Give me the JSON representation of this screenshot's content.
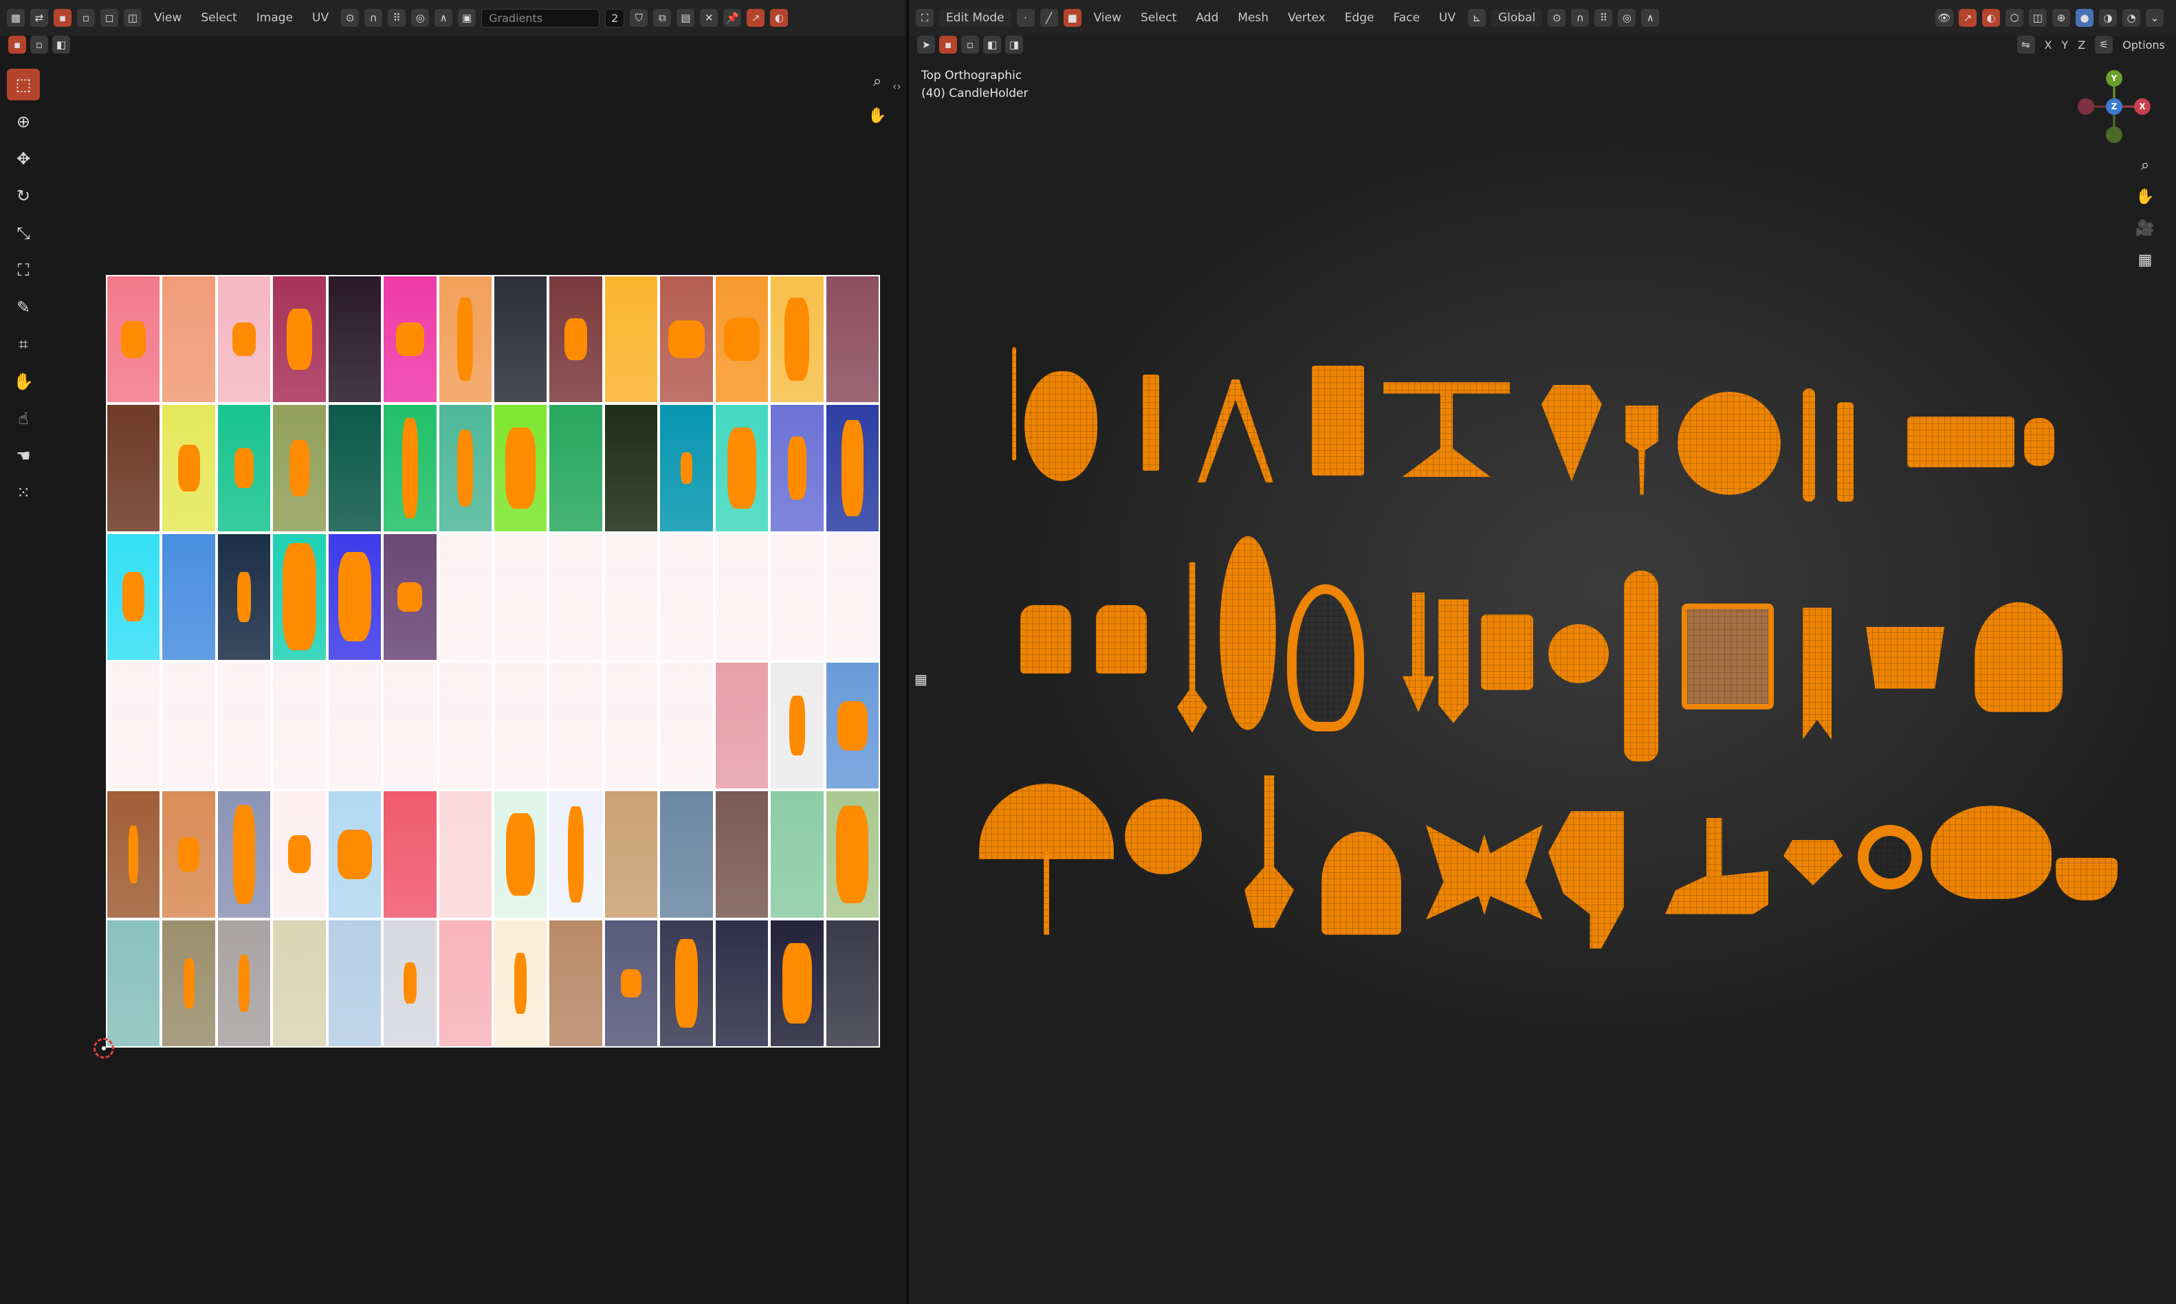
{
  "uv_editor": {
    "header": {
      "menus": [
        "View",
        "Select",
        "Image",
        "UV"
      ],
      "image_name": "Gradients",
      "users_count": "2"
    },
    "nav_icons": [
      "zoom-icon",
      "hand-icon"
    ],
    "tools": [
      "select-box-icon",
      "cursor-icon",
      "move-icon",
      "rotate-icon",
      "scale-icon",
      "transform-icon",
      "annotate-icon",
      "rip-icon",
      "grab-icon",
      "relax-icon",
      "pinch-icon",
      "sample-icon"
    ],
    "grid": {
      "columns": 14,
      "rows": 6,
      "tiles": [
        [
          "#f37a8a",
          "#f19c78",
          "#f5b8c3",
          "#a9335a",
          "#2a1a28",
          "#ee3aa8",
          "#f2a05b",
          "#2f2f3a",
          "#7b3b3d",
          "#fbb52f",
          "#b65e52",
          "#f79a2c",
          "#f7c04b",
          "#8d4f61"
        ],
        [
          "#6f3b26",
          "#e6e85a",
          "#19c48e",
          "#93a05a",
          "#0e5a4a",
          "#22c068",
          "#4fb899",
          "#7ee62e",
          "#28a85f",
          "#1e2f15",
          "#0897b0",
          "#43d8c0",
          "#6b73d6",
          "#2d3fa4"
        ],
        [
          "#35dff4",
          "#4a8ee0",
          "#1b2f48",
          "#1fd1b4",
          "#3e3bea",
          "#6b4877",
          "#fdf2f4",
          "#fdf2f4",
          "#fdf2f4",
          "#fdf2f4",
          "#fdf2f4",
          "#fdf2f4",
          "#fdf2f4",
          "#fdf2f4"
        ],
        [
          "#fdf2f4",
          "#fdf2f4",
          "#fdf2f4",
          "#fdf2f4",
          "#fdf2f4",
          "#fdf2f4",
          "#fdf2f4",
          "#fdf2f4",
          "#fdf2f4",
          "#fdf2f4",
          "#fdf2f4",
          "#e7a0aa",
          "#ececec",
          "#6a9bd9"
        ],
        [
          "#a05f37",
          "#d98c57",
          "#8c94b6",
          "#fdeff2",
          "#b3d9f2",
          "#f05a6e",
          "#fbd9da",
          "#dff5ea",
          "#eef0fb",
          "#c8a274",
          "#6c88a4",
          "#7b5c55",
          "#8ccca5",
          "#a9c990"
        ],
        [
          "#8ac1bd",
          "#9b8f6d",
          "#a9a3a3",
          "#dbd5b5",
          "#b7cfe6",
          "#d8d9e0",
          "#f8b4bb",
          "#fbeed8",
          "#b98a68",
          "#5a5a7c",
          "#3b3b56",
          "#2f2f4a",
          "#24233a",
          "#3b3b4a"
        ]
      ]
    }
  },
  "viewport": {
    "header": {
      "mode": "Edit Mode",
      "menus": [
        "View",
        "Select",
        "Add",
        "Mesh",
        "Vertex",
        "Edge",
        "Face",
        "UV"
      ],
      "orientation": "Global",
      "options_label": "Options",
      "axes": [
        "X",
        "Y",
        "Z"
      ]
    },
    "view_name": "Top Orthographic",
    "object_info": "(40) CandleHolder",
    "gizmo_axes": [
      "X",
      "Y",
      "Z"
    ],
    "nav_icons": [
      "zoom-icon",
      "hand-icon",
      "camera-icon",
      "grid-icon"
    ]
  }
}
